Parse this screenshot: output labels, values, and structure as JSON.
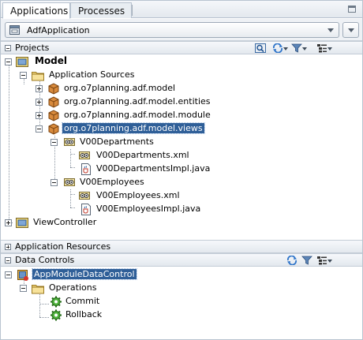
{
  "tabs": [
    {
      "label": "Applications",
      "active": true
    },
    {
      "label": "Processes",
      "active": false
    }
  ],
  "application_selector": {
    "value": "AdfApplication"
  },
  "sections": {
    "projects": {
      "title": "Projects",
      "expanded": true
    },
    "application_resources": {
      "title": "Application Resources",
      "expanded": false
    },
    "data_controls": {
      "title": "Data Controls",
      "expanded": true
    }
  },
  "project_tree": {
    "model": "Model",
    "application_sources": "Application Sources",
    "packages": [
      "org.o7planning.adf.model",
      "org.o7planning.adf.model.entities",
      "org.o7planning.adf.model.module",
      "org.o7planning.adf.model.views"
    ],
    "v00departments": "V00Departments",
    "v00departments_xml": "V00Departments.xml",
    "v00departments_impl": "V00DepartmentsImpl.java",
    "v00employees": "V00Employees",
    "v00employees_xml": "V00Employees.xml",
    "v00employees_impl": "V00EmployeesImpl.java",
    "view_controller": "ViewController"
  },
  "data_controls_tree": {
    "root": "AppModuleDataControl",
    "operations": "Operations",
    "commit": "Commit",
    "rollback": "Rollback"
  },
  "colors": {
    "selection": "#2f5f98",
    "package_icon": "#c9782a",
    "folder_icon": "#e8c15a",
    "gear_icon": "#3c9a2e"
  }
}
